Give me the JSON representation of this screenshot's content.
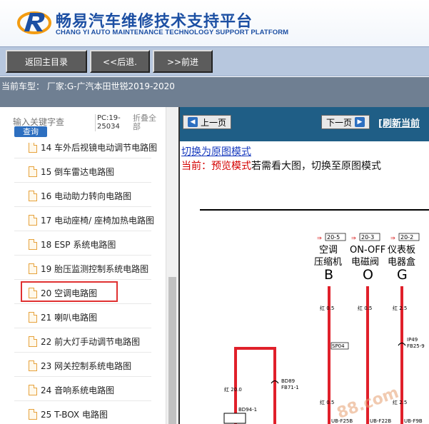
{
  "header": {
    "title_cn": "畅易汽车维修技术支持平台",
    "title_en": "CHANG YI AUTO MAINTENANCE TECHNOLOGY SUPPORT PLATFORM"
  },
  "nav": {
    "home_label": "返回主目录",
    "back_label": "<<后退.",
    "forward_label": ">>前进"
  },
  "model_bar": {
    "text": "当前车型： 厂家:G-广汽本田世锐2019-2020"
  },
  "left": {
    "search_placeholder": "输入关键字查",
    "search_button": "查询",
    "pc_label": "PC:19-25034",
    "collapse_label": "折叠全部"
  },
  "tree": [
    {
      "label": "14 车外后视镜电动调节电路图"
    },
    {
      "label": "15 倒车雷达电路图"
    },
    {
      "label": "16 电动助力转向电路图"
    },
    {
      "label": "17 电动座椅/ 座椅加热电路图"
    },
    {
      "label": "18 ESP 系统电路图"
    },
    {
      "label": "19 胎压监测控制系统电路图"
    },
    {
      "label": "20 空调电路图"
    },
    {
      "label": "21 喇叭电路图"
    },
    {
      "label": "22 前大灯手动调节电路图"
    },
    {
      "label": "23 网关控制系统电路图"
    },
    {
      "label": "24 音响系统电路图"
    },
    {
      "label": "25 T-BOX 电路图"
    }
  ],
  "right": {
    "prev_page": "上一页",
    "next_page": "下一页",
    "refresh_label": "[刷新当前",
    "switch_link": "切换为原图模式",
    "mode_prefix": "当前：预览模式",
    "mode_suffix": "若需看大图，切换至原图模式"
  },
  "diagram": {
    "refs": [
      "20-5",
      "20-3",
      "20-2"
    ],
    "names": [
      {
        "line1": "空调",
        "line2": "压缩机",
        "letter": "B"
      },
      {
        "line1": "ON-OFF",
        "line2": "电磁阀",
        "letter": "O"
      },
      {
        "line1": "仪表板",
        "line2": "电器盒",
        "letter": "G"
      }
    ],
    "wire_labels": [
      "红 0.5",
      "红 0.5",
      "红 2.5",
      "红 20.0",
      "红 0.5",
      "红 2.5"
    ],
    "connectors": [
      "SP04",
      "IP49",
      "FB25-9",
      "BD89",
      "FB71-1",
      "BD94-1",
      "UB-F25B",
      "UB-F22B",
      "UB-F9B"
    ],
    "watermark": "88.com"
  },
  "colors": {
    "brand_blue": "#1c4fa3",
    "toolbar_blue": "#1f5e86",
    "wire_red": "#e0202a",
    "highlight_red": "#e03131"
  }
}
